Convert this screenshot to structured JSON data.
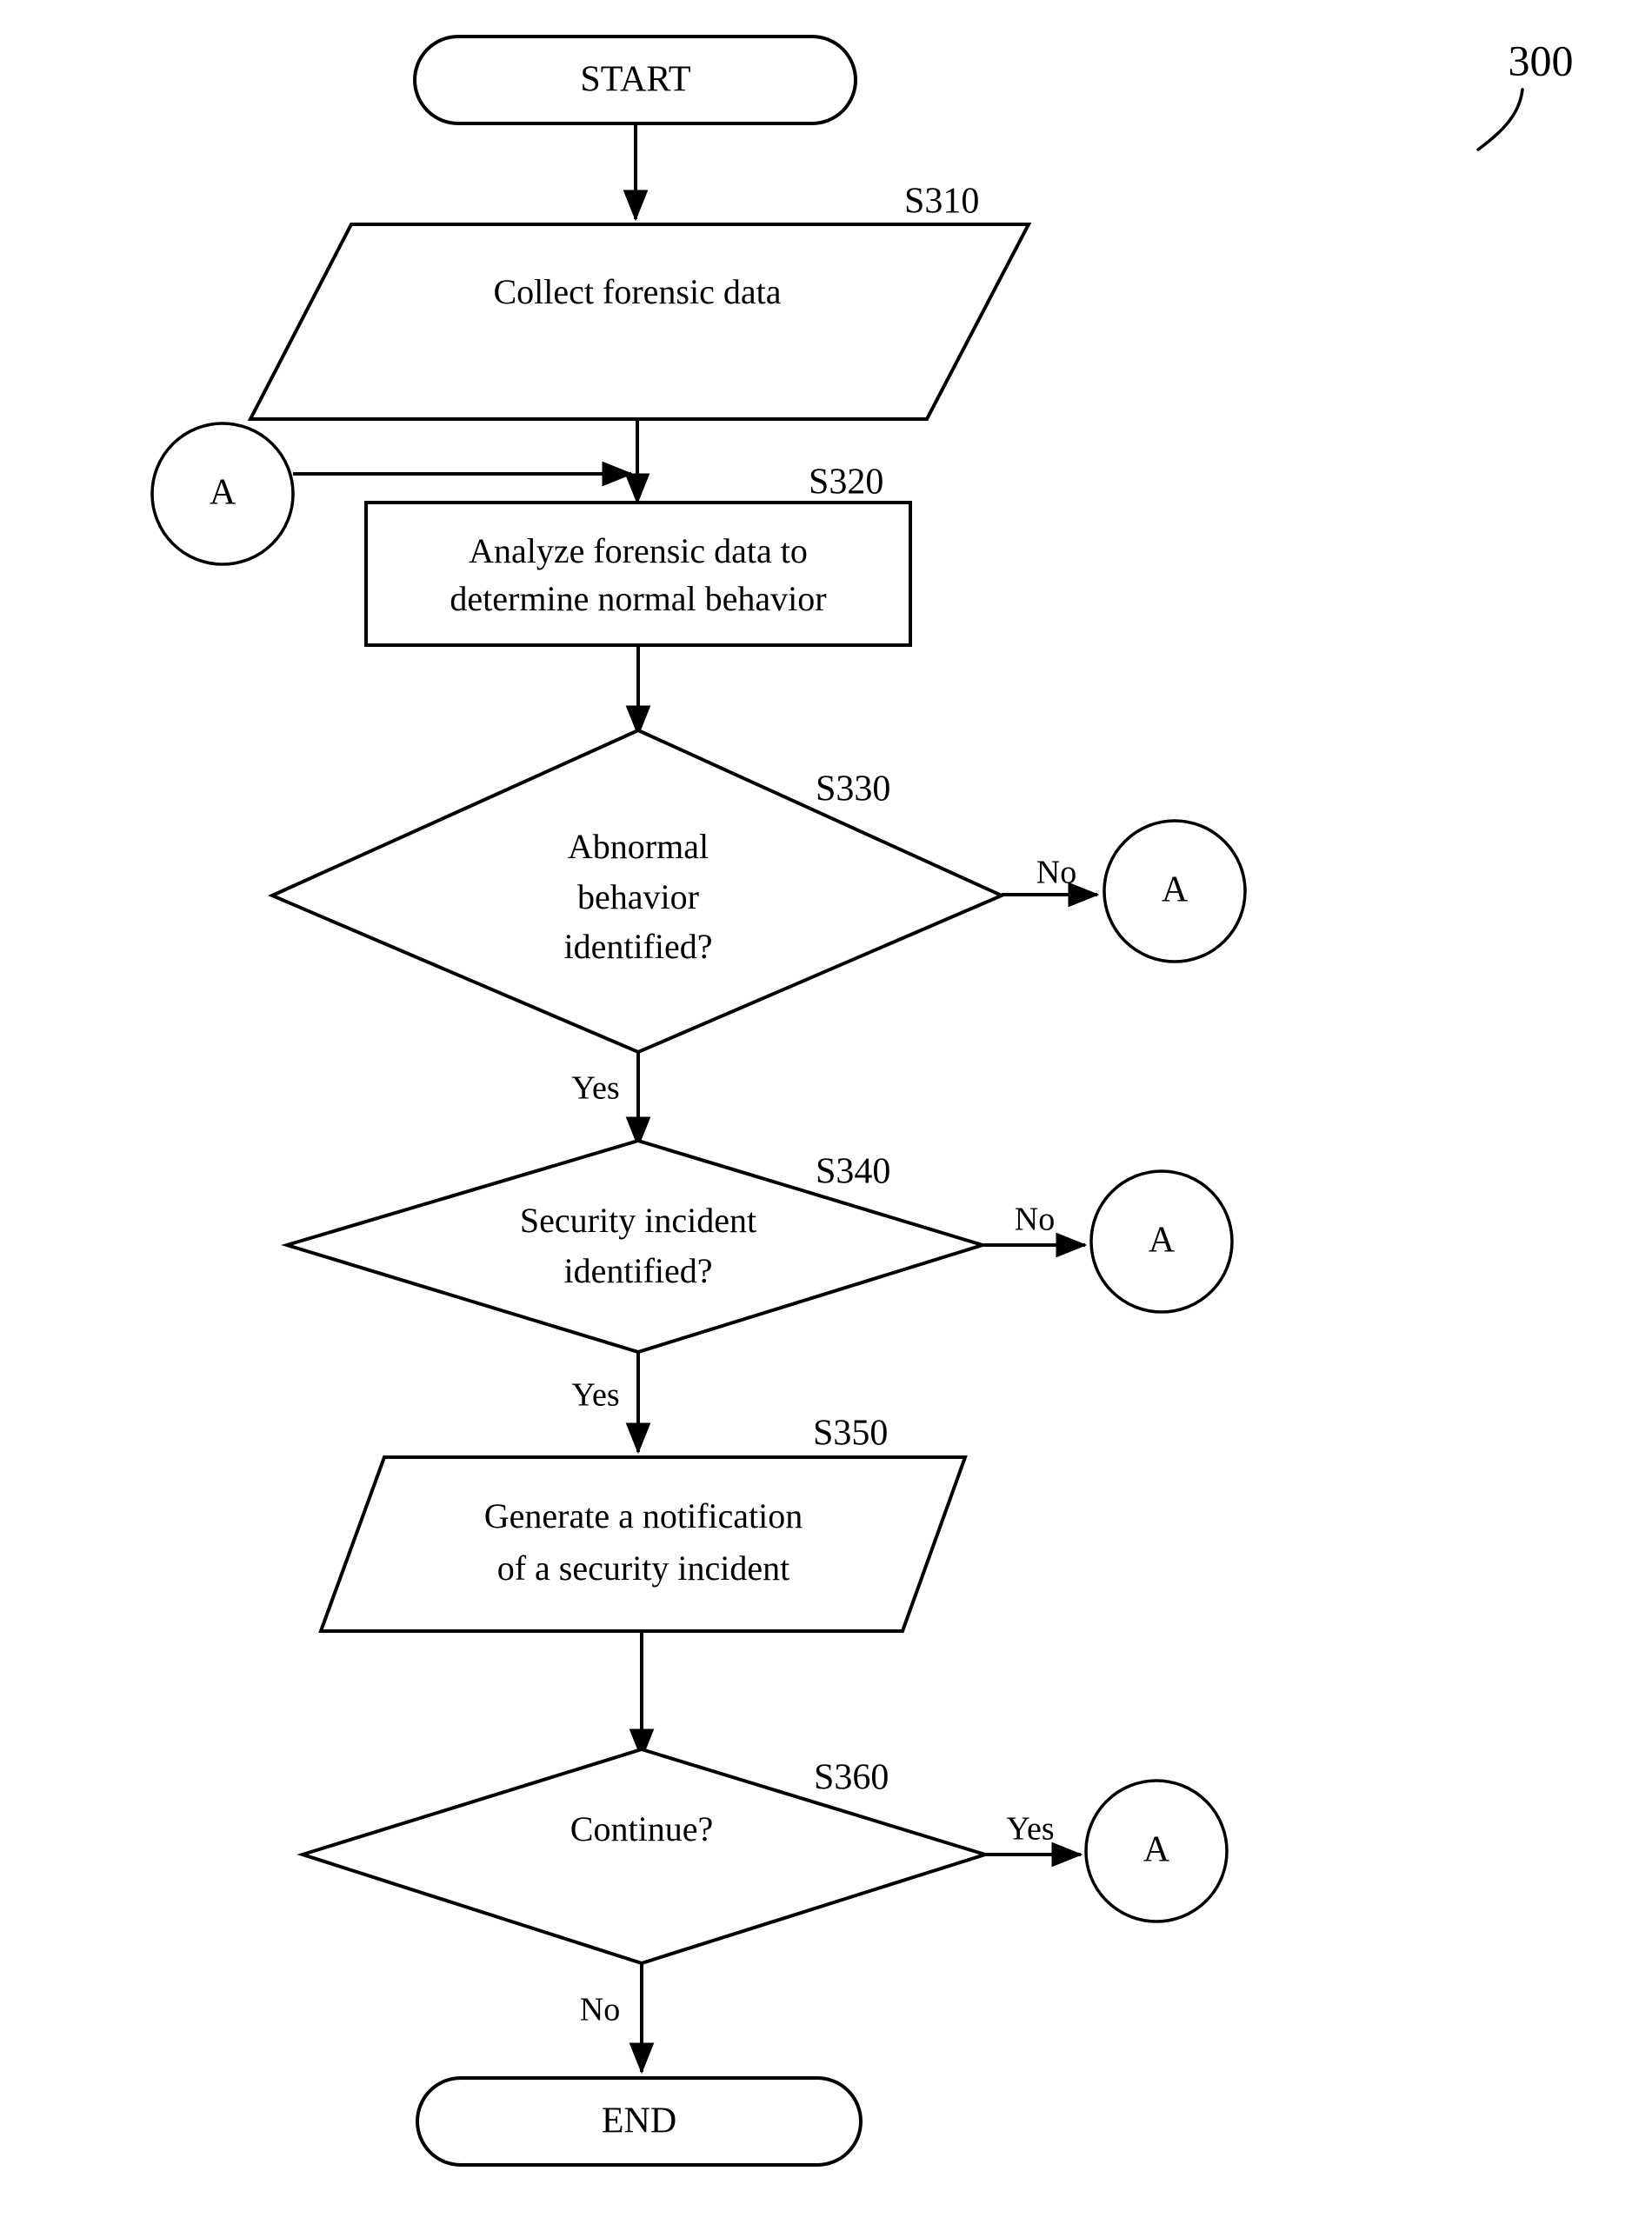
{
  "figure": {
    "number": "300",
    "type": "flowchart"
  },
  "nodes": {
    "start": {
      "label": "START",
      "shape": "terminator"
    },
    "s310": {
      "step": "S310",
      "label": "Collect forensic data",
      "lines": [
        "Collect forensic data"
      ],
      "shape": "parallelogram"
    },
    "s320": {
      "step": "S320",
      "label": "Analyze forensic data to determine normal behavior",
      "lines": [
        "Analyze forensic data to",
        "determine normal behavior"
      ],
      "shape": "process"
    },
    "s330": {
      "step": "S330",
      "label": "Abnormal behavior identified?",
      "lines": [
        "Abnormal",
        "behavior",
        "identified?"
      ],
      "shape": "decision"
    },
    "s340": {
      "step": "S340",
      "label": "Security incident identified?",
      "lines": [
        "Security incident",
        "identified?"
      ],
      "shape": "decision"
    },
    "s350": {
      "step": "S350",
      "label": "Generate a notification of a security incident",
      "lines": [
        "Generate a notification",
        "of a security incident"
      ],
      "shape": "parallelogram"
    },
    "s360": {
      "step": "S360",
      "label": "Continue?",
      "lines": [
        "Continue?"
      ],
      "shape": "decision"
    },
    "end": {
      "label": "END",
      "shape": "terminator"
    }
  },
  "connectors": {
    "a_left": {
      "label": "A"
    },
    "a_s330": {
      "label": "A"
    },
    "a_s340": {
      "label": "A"
    },
    "a_s360": {
      "label": "A"
    }
  },
  "branches": {
    "s330_no": "No",
    "s330_yes": "Yes",
    "s340_no": "No",
    "s340_yes": "Yes",
    "s360_yes": "Yes",
    "s360_no": "No"
  },
  "colors": {
    "stroke": "#000000",
    "fill": "#ffffff",
    "background": "#ffffff"
  }
}
